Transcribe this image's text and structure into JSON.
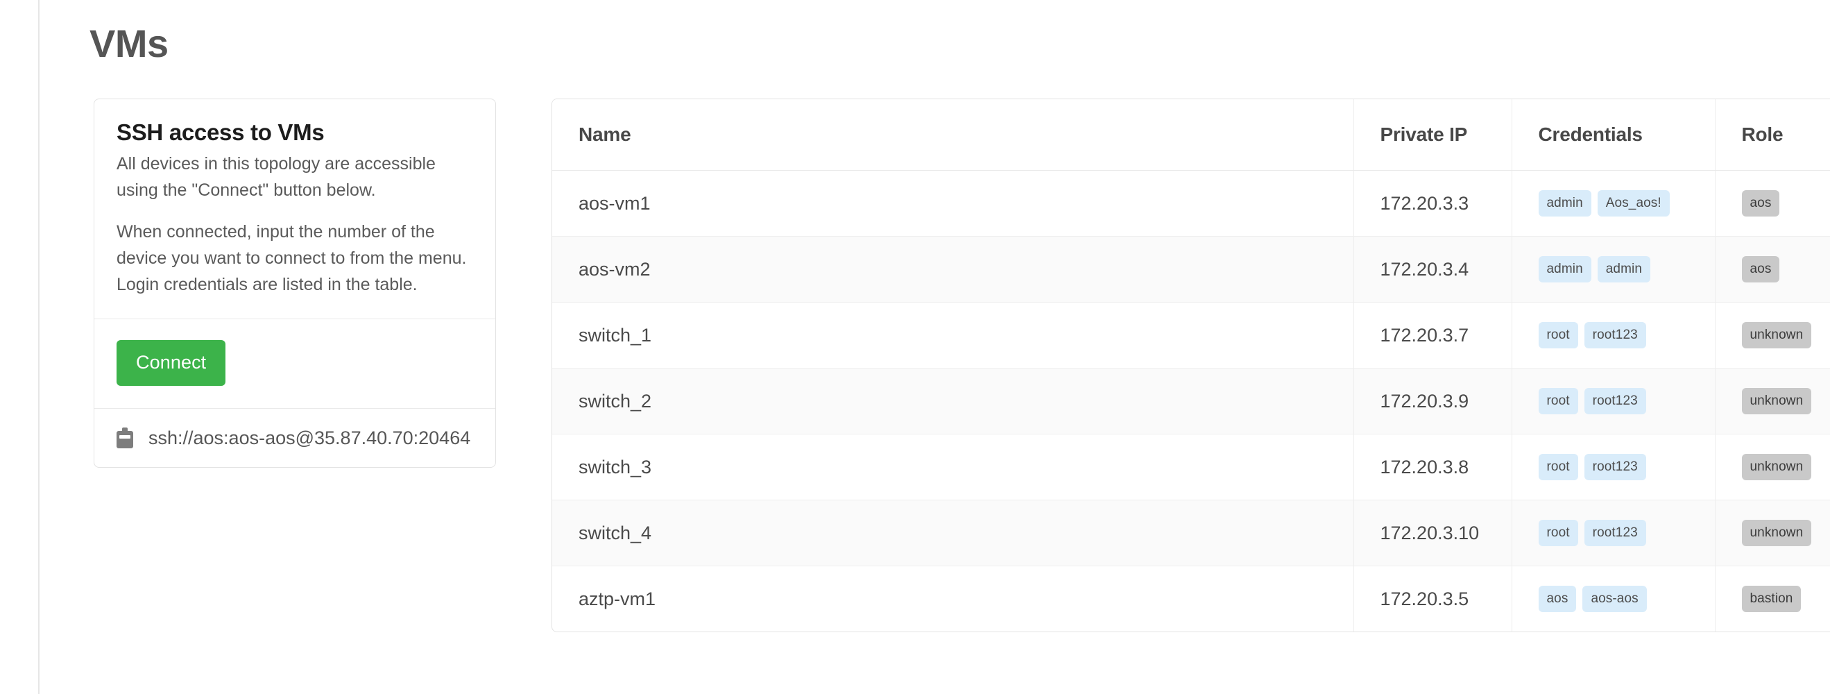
{
  "page": {
    "title": "VMs"
  },
  "ssh_card": {
    "title": "SSH access to VMs",
    "paragraph1": "All devices in this topology are accessible using the \"Connect\" button below.",
    "paragraph2": "When connected, input the number of the device you want to connect to from the menu. Login credentials are listed in the table.",
    "connect_label": "Connect",
    "copy_icon": "clipboard-icon",
    "ssh_url": "ssh://aos:aos-aos@35.87.40.70:20464"
  },
  "table": {
    "columns": [
      "Name",
      "Private IP",
      "Credentials",
      "Role"
    ],
    "rows": [
      {
        "name": "aos-vm1",
        "private_ip": "172.20.3.3",
        "credentials": [
          "admin",
          "Aos_aos!"
        ],
        "role": "aos"
      },
      {
        "name": "aos-vm2",
        "private_ip": "172.20.3.4",
        "credentials": [
          "admin",
          "admin"
        ],
        "role": "aos"
      },
      {
        "name": "switch_1",
        "private_ip": "172.20.3.7",
        "credentials": [
          "root",
          "root123"
        ],
        "role": "unknown"
      },
      {
        "name": "switch_2",
        "private_ip": "172.20.3.9",
        "credentials": [
          "root",
          "root123"
        ],
        "role": "unknown"
      },
      {
        "name": "switch_3",
        "private_ip": "172.20.3.8",
        "credentials": [
          "root",
          "root123"
        ],
        "role": "unknown"
      },
      {
        "name": "switch_4",
        "private_ip": "172.20.3.10",
        "credentials": [
          "root",
          "root123"
        ],
        "role": "unknown"
      },
      {
        "name": "aztp-vm1",
        "private_ip": "172.20.3.5",
        "credentials": [
          "aos",
          "aos-aos"
        ],
        "role": "bastion"
      }
    ]
  },
  "colors": {
    "connect_green": "#3cb34a",
    "credential_badge": "#d9ecfa",
    "role_badge": "#c9c9c9",
    "row_alt": "#fafafa",
    "border": "#e9e9e9"
  }
}
